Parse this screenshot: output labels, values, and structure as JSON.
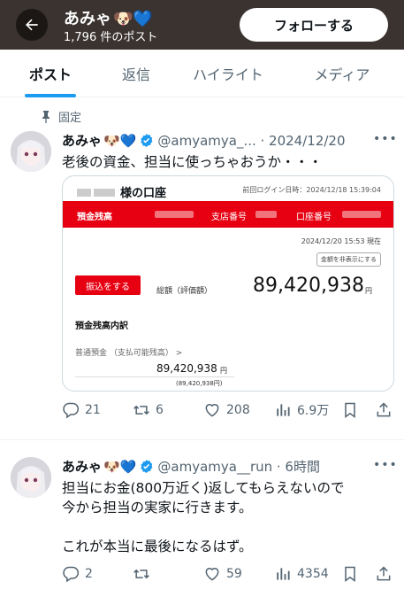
{
  "header": {
    "name": "あみゃ",
    "posts_count": "1,796 件のポスト",
    "follow_label": "フォローする"
  },
  "tabs": [
    {
      "label": "ポスト"
    },
    {
      "label": "返信"
    },
    {
      "label": "ハイライト"
    },
    {
      "label": "メディア"
    }
  ],
  "posts": [
    {
      "pinned_label": "固定",
      "name": "あみゃ",
      "meta": "@amyamya_... · 2024/12/20",
      "text_lines": [
        "老後の資金、担当に使っちゃおうか・・・"
      ],
      "card": {
        "title": "様の口座",
        "last_login": "前回ログイン日時：2024/12/18 15:39:04",
        "balance_label": "預金残高",
        "branch_label": "支店番号",
        "account_label": "口座番号",
        "as_of": "2024/12/20 15:53 現在",
        "hide_button": "金額を非表示にする",
        "transfer_button": "振込をする",
        "total_label": "総額（評価額）",
        "total_amount": "89,420,938",
        "yen": "円",
        "breakdown_title": "預金残高内訳",
        "ordinary_label": "普通預金 （支払可能残高） >",
        "ordinary_amount": "89,420,938",
        "ordinary_sub": "(89,420,938円)"
      },
      "stats": {
        "replies": "21",
        "reposts": "6",
        "likes": "208",
        "views": "6.9万"
      }
    },
    {
      "name": "あみゃ",
      "meta": "@amyamya__run · 6時間",
      "text_lines": [
        "担当にお金(800万近く)返してもらえないので",
        "今から担当の実家に行きます。",
        "",
        "これが本当に最後になるはず。"
      ],
      "stats": {
        "replies": "2",
        "reposts": "",
        "likes": "59",
        "views": "4354"
      }
    }
  ],
  "colors": {
    "accent": "#1d9bf0",
    "bank_red": "#e60012",
    "header_bg": "#3a3330"
  }
}
